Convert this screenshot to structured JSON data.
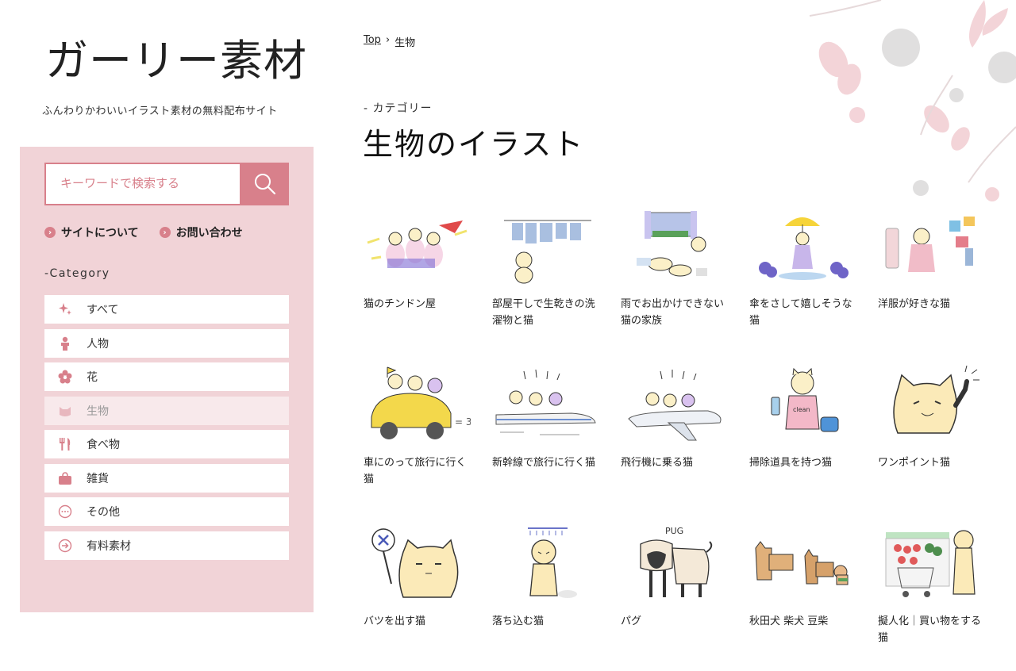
{
  "site": {
    "logo": "ガーリー素材",
    "tagline": "ふんわりかわいいイラスト素材の無料配布サイト"
  },
  "search": {
    "placeholder": "キーワードで検索する",
    "button_icon": "search-icon"
  },
  "nav_links": [
    {
      "label": "サイトについて",
      "icon": "arrow-circle-icon"
    },
    {
      "label": "お問い合わせ",
      "icon": "arrow-circle-icon"
    }
  ],
  "categories": {
    "heading": "-Category",
    "items": [
      {
        "label": "すべて",
        "icon": "sparkle-icon"
      },
      {
        "label": "人物",
        "icon": "person-icon"
      },
      {
        "label": "花",
        "icon": "flower-icon"
      },
      {
        "label": "生物",
        "icon": "cat-icon",
        "active": true
      },
      {
        "label": "食べ物",
        "icon": "cutlery-icon"
      },
      {
        "label": "雑貨",
        "icon": "bag-icon"
      },
      {
        "label": "その他",
        "icon": "ellipsis-icon"
      },
      {
        "label": "有料素材",
        "icon": "arrow-circle-icon"
      }
    ]
  },
  "breadcrumb": {
    "home": "Top",
    "separator": "›",
    "current": "生物"
  },
  "header": {
    "eyebrow": "- カテゴリー",
    "title": "生物のイラスト"
  },
  "colors": {
    "accent": "#d8808b",
    "panel": "#f1d3d7",
    "active_item": "#f8e9eb"
  },
  "illustrations": [
    {
      "title": "猫のチンドン屋",
      "icon": "cats-parade-illustration"
    },
    {
      "title": "部屋干しで生乾きの洗濯物と猫",
      "icon": "laundry-cat-illustration"
    },
    {
      "title": "雨でお出かけできない猫の家族",
      "icon": "rainy-day-cats-illustration"
    },
    {
      "title": "傘をさして嬉しそうな猫",
      "icon": "umbrella-cat-illustration"
    },
    {
      "title": "洋服が好きな猫",
      "icon": "fashion-cat-illustration"
    },
    {
      "title": "車にのって旅行に行く猫",
      "icon": "car-trip-cats-illustration"
    },
    {
      "title": "新幹線で旅行に行く猫",
      "icon": "bullet-train-cats-illustration"
    },
    {
      "title": "飛行機に乗る猫",
      "icon": "airplane-cats-illustration"
    },
    {
      "title": "掃除道具を持つ猫",
      "icon": "cleaning-cat-illustration"
    },
    {
      "title": "ワンポイント猫",
      "icon": "pointing-cat-illustration"
    },
    {
      "title": "バツを出す猫",
      "icon": "x-sign-cat-illustration"
    },
    {
      "title": "落ち込む猫",
      "icon": "sad-cat-illustration"
    },
    {
      "title": "パグ",
      "icon": "pug-illustration",
      "caption_text": "PUG"
    },
    {
      "title": "秋田犬 柴犬 豆柴",
      "icon": "three-dogs-illustration"
    },
    {
      "title": "擬人化｜買い物をする猫",
      "icon": "shopping-cat-illustration"
    }
  ]
}
